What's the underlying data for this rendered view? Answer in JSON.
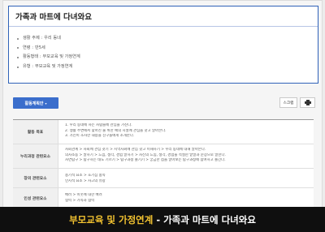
{
  "title_card": {
    "title": "가족과 마트에 다녀와요",
    "info": [
      {
        "key": "생활 주제 :",
        "value": "우리 동네"
      },
      {
        "key": "연령 :",
        "value": "만5세"
      },
      {
        "key": "활동형태 :",
        "value": "부모교육 및 가정연계"
      },
      {
        "key": "유형 :",
        "value": "부모교육 및 가정연계"
      }
    ]
  },
  "toolbar": {
    "plan_button": "활동계획안",
    "plan_caret": "▾",
    "scrap_button": "스크랩"
  },
  "plan_table": {
    "rows": [
      {
        "label": "활동 목표",
        "lines": [
          "1. 우리 동네에 사는 사람들에 관심을 가진다.",
          "2. 생활 주변에서 찾아진 물 위한 예의 시설에 관심을 갖고 알아본다.",
          "3. 가신이 조사한 내용을 친구들에게 소개한다."
        ]
      },
      {
        "label": "누리과정 관련요소",
        "lines": [
          "사회관계 > 사회에 관심 갖기 > 지역사회에 관심 갖고 이해하기 > 우리 동네에 대해 알아본다.",
          "의사소통 > 말하기 > 느낌, 생각, 경험 말하기 > 자신의 느낌, 생각, 경험을 적절한 낱말과 문장으로 말한다.",
          "자연탐구 > 탐구하는 태도 기르기 > 탐구과정 즐기기 > 궁금한 점을 알아보는 탐구과정에 참여하고 즐긴다."
        ]
      },
      {
        "label": "창의 관련요소",
        "lines": [
          "용기적 요소 > 호기심 충족",
          "인지적 요소 > 사고의 유창"
        ]
      },
      {
        "label": "인성 관련요소",
        "lines": [
          "배려 > 이웃에 대한 배려",
          "협력 > 가족과 협력"
        ]
      }
    ]
  },
  "caption": {
    "highlight": "부모교육 및 가정연계",
    "separator": "-",
    "rest": "가족과 마트에 다녀와요"
  }
}
